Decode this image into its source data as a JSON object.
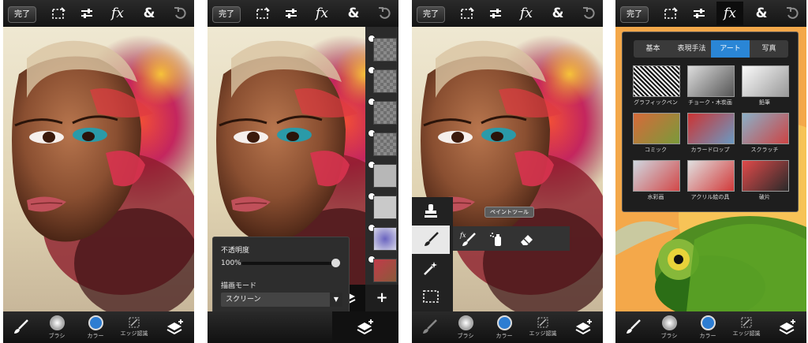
{
  "toolbar": {
    "done_label": "完了"
  },
  "bottom_bar": {
    "brush_label": "ブラシ",
    "color_label": "カラー",
    "edge_label": "エッジ認識",
    "brush_ring_color": "#c8c8c8",
    "color_fill": "#2d7dd2"
  },
  "layer_panel": {
    "opacity_label": "不透明度",
    "opacity_value": "100%",
    "opacity_fraction": 1.0,
    "blend_label": "描画モード",
    "blend_value": "スクリーン"
  },
  "tools": {
    "tooltip": "ペイントツール"
  },
  "fx": {
    "tabs": [
      {
        "label": "基本"
      },
      {
        "label": "表現手法"
      },
      {
        "label": "アート"
      },
      {
        "label": "写真"
      }
    ],
    "selected_tab": "アート",
    "items": [
      {
        "label": "グラフィックペン"
      },
      {
        "label": "チョーク・木炭画"
      },
      {
        "label": "鉛筆"
      },
      {
        "label": "コミック"
      },
      {
        "label": "カラードロップ"
      },
      {
        "label": "スクラッチ"
      },
      {
        "label": "水彩画"
      },
      {
        "label": "アクリル絵の具"
      },
      {
        "label": "破片"
      }
    ]
  },
  "colors": {
    "accent": "#2a86d6",
    "bar_dark": "#1a1a1a"
  }
}
